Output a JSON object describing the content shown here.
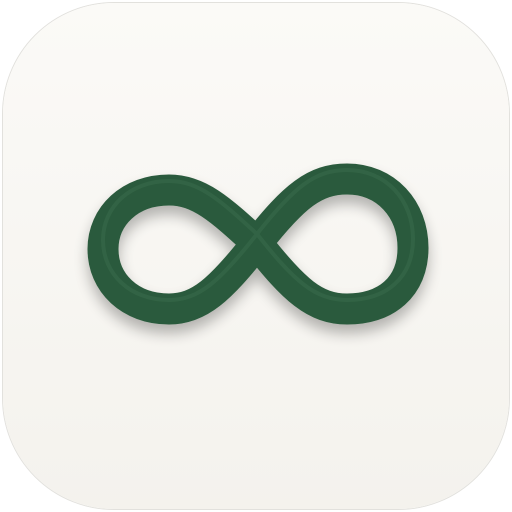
{
  "app_icon": {
    "glyph": "infinity-icon",
    "colors": {
      "tile_background_top": "#fbfaf7",
      "tile_background_bottom": "#f4f2ed",
      "tile_border": "#e2e1dd",
      "glyph_stroke": "#2b5a3c",
      "glyph_highlight": "#3a7050",
      "glyph_shadow": "#0f2418"
    }
  }
}
